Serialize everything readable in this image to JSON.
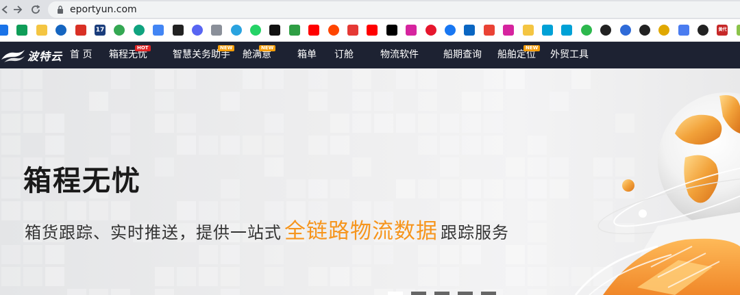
{
  "browser": {
    "url": "eportyun.com"
  },
  "bookmarks": [
    {
      "icon": "green-grid-icon",
      "color": "#1a73e8"
    },
    {
      "icon": "sheets-icon",
      "color": "#0f9d58"
    },
    {
      "icon": "folder-icon",
      "color": "#f4c542"
    },
    {
      "icon": "globe-network-icon",
      "color": "#1565c0"
    },
    {
      "icon": "red-square-app-icon",
      "color": "#d93025"
    },
    {
      "icon": "17-app-icon",
      "color": "#1a3d7c",
      "text": "17"
    },
    {
      "icon": "maps-pin-icon",
      "color": "#34a853"
    },
    {
      "icon": "chatgpt-icon",
      "color": "#10a37f"
    },
    {
      "icon": "gemini-sparkle-icon",
      "color": "#4285f4"
    },
    {
      "icon": "black-app-icon",
      "color": "#222222"
    },
    {
      "icon": "discord-icon",
      "color": "#5865f2"
    },
    {
      "icon": "sail-icon",
      "color": "#8a8f99"
    },
    {
      "icon": "telegram-icon",
      "color": "#2aa3df"
    },
    {
      "icon": "whatsapp-icon",
      "color": "#25d366"
    },
    {
      "icon": "tiktok-icon",
      "color": "#111111"
    },
    {
      "icon": "phone-app-icon",
      "color": "#2e9e44"
    },
    {
      "icon": "youtube-icon",
      "color": "#ff0000"
    },
    {
      "icon": "reddit-icon",
      "color": "#ff4500"
    },
    {
      "icon": "g-app-icon",
      "color": "#e53935"
    },
    {
      "icon": "youtube-icon-2",
      "color": "#ff0000"
    },
    {
      "icon": "x-icon",
      "color": "#000000"
    },
    {
      "icon": "instagram-icon",
      "color": "#d6249f"
    },
    {
      "icon": "weibo-icon",
      "color": "#e6162d"
    },
    {
      "icon": "facebook-icon",
      "color": "#1877f2"
    },
    {
      "icon": "zhihu-icon",
      "color": "#0a66c2"
    },
    {
      "icon": "gmail-icon",
      "color": "#ea4335"
    },
    {
      "icon": "instagram-icon-2",
      "color": "#d6249f"
    },
    {
      "icon": "notes-icon",
      "color": "#f4c542"
    },
    {
      "icon": "bilibili-icon",
      "color": "#00a1d6"
    },
    {
      "icon": "bilibili-icon-2",
      "color": "#00a1d6"
    },
    {
      "icon": "green-leaf-icon",
      "color": "#2db84d"
    },
    {
      "icon": "globe-icon",
      "color": "#222222"
    },
    {
      "icon": "paw-icon",
      "color": "#2f6bd8"
    },
    {
      "icon": "globe-icon-2",
      "color": "#222222"
    },
    {
      "icon": "emoji-icon",
      "color": "#e0a800"
    },
    {
      "icon": "translate-icon",
      "color": "#4a7cf0"
    },
    {
      "icon": "globe-icon-3",
      "color": "#222222"
    },
    {
      "icon": "red-text-app-icon",
      "color": "#c62828",
      "text": "黄代"
    },
    {
      "icon": "green-app-icon",
      "color": "#8bc34a"
    }
  ],
  "site": {
    "logo_text": "波特云",
    "nav": [
      {
        "label": "首 页"
      },
      {
        "label": "箱程无忧",
        "badge": "HOT"
      },
      {
        "label": "智慧关务助手",
        "badge": "NEW"
      },
      {
        "label": "舱满意",
        "badge": "NEW"
      },
      {
        "label": "箱单"
      },
      {
        "label": "订舱"
      },
      {
        "label": "物流软件"
      },
      {
        "label": "船期查询"
      },
      {
        "label": "船舶定位",
        "badge": "NEW"
      },
      {
        "label": "外贸工具"
      }
    ]
  },
  "hero": {
    "title": "箱程无忧",
    "subtitle_pre": "箱货跟踪、实时推送，提供一站式",
    "subtitle_highlight": "全链路物流数据",
    "subtitle_post": "跟踪服务",
    "carousel_active": 0,
    "carousel_count": 5
  }
}
